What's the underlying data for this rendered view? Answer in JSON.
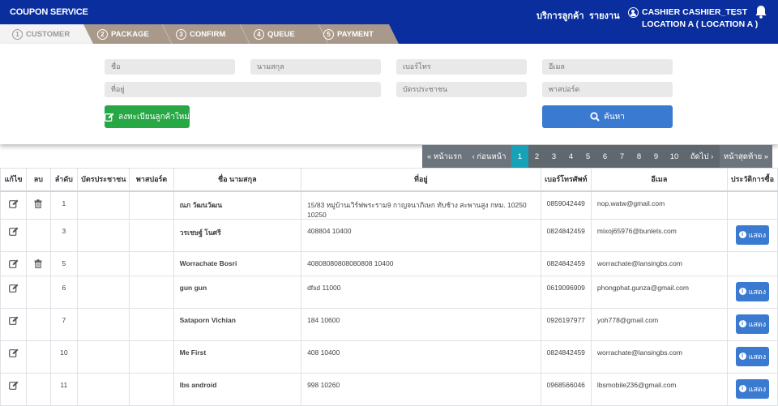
{
  "header": {
    "brand": "COUPON SERVICE",
    "nav_customer_service": "บริการลูกค้า",
    "nav_report": "รายงาน",
    "user_name": "CASHIER CASHIER_TEST",
    "user_location": "LOCATION A ( LOCATION A )"
  },
  "steps": [
    {
      "num": "1",
      "label": "CUSTOMER"
    },
    {
      "num": "2",
      "label": "PACKAGE"
    },
    {
      "num": "3",
      "label": "CONFIRM"
    },
    {
      "num": "4",
      "label": "QUEUE"
    },
    {
      "num": "5",
      "label": "PAYMENT"
    }
  ],
  "search": {
    "first_name_placeholder": "ชื่อ",
    "last_name_placeholder": "นามสกุล",
    "phone_placeholder": "เบอร์โทร",
    "email_placeholder": "อีเมล",
    "address_placeholder": "ที่อยู่",
    "id_card_placeholder": "บัตรประชาชน",
    "passport_placeholder": "พาสปอร์ต",
    "register_label": "ลงทะเบียนลูกค้าใหม่",
    "search_label": "ค้นหา"
  },
  "pagination": {
    "first": "« หน้าแรก",
    "prev": "‹ ก่อนหน้า",
    "pages": [
      "1",
      "2",
      "3",
      "4",
      "5",
      "6",
      "7",
      "8",
      "9",
      "10"
    ],
    "active_page": "1",
    "next": "ถัดไป ›",
    "last": "หน้าสุดท้าย »"
  },
  "table": {
    "headers": {
      "edit": "แก้ไข",
      "delete": "ลบ",
      "index": "ลำดับ",
      "id_card": "บัตรประชาชน",
      "passport": "พาสปอร์ต",
      "name": "ชื่อ นามสกุล",
      "address": "ที่อยู่",
      "phone": "เบอร์โทรศัพท์",
      "email": "อีเมล",
      "history": "ประวัติการซื้อ"
    },
    "show_label": "แสดง",
    "rows": [
      {
        "index": "1",
        "name": "ณภ วัฒนวัฒน",
        "address": "15/83 หมู่บ้านเวิร์ฟพระราม9 กาญจนาภิเษก ทับช้าง สะพานสูง กทม. 10250 10250",
        "phone": "0859042449",
        "email": "nop.watw@gmail.com"
      },
      {
        "index": "3",
        "name": "วรเชษฐ์ โนศรี",
        "address": "408804 10400",
        "phone": "0824842459",
        "email": "mixoj65976@bunlets.com"
      },
      {
        "index": "5",
        "name": "Worrachate Bosri",
        "address": "40808080808080808 10400",
        "phone": "0824842459",
        "email": "worrachate@lansingbs.com"
      },
      {
        "index": "6",
        "name": "gun gun",
        "address": "dfsd 11000",
        "phone": "0619096909",
        "email": "phongphat.gunza@gmail.com"
      },
      {
        "index": "7",
        "name": "Sataporn Vichian",
        "address": "184 10600",
        "phone": "0926197977",
        "email": "yoh778@gmail.com"
      },
      {
        "index": "10",
        "name": "Me First",
        "address": "408 10400",
        "phone": "0824842459",
        "email": "worrachate@lansingbs.com"
      },
      {
        "index": "11",
        "name": "lbs android",
        "address": "998 10260",
        "phone": "0968566046",
        "email": "lbsmobile236@gmail.com"
      }
    ]
  },
  "colors": {
    "header_bg": "#0a2e9e",
    "step_bg": "#a8998a",
    "green": "#28a745",
    "blue": "#3a7ad1",
    "pager_active": "#17a2b8"
  }
}
